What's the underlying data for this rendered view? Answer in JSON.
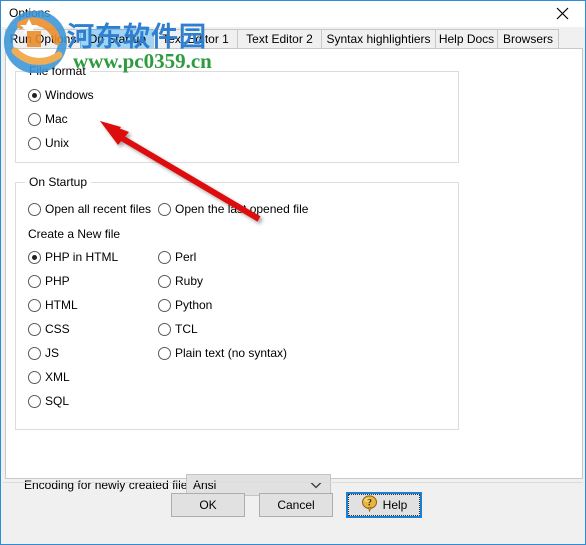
{
  "window": {
    "title": "Options",
    "close_icon": "close-icon",
    "border_color": "#2e8bd6"
  },
  "tabs": [
    {
      "label": "Run Options",
      "selected": false
    },
    {
      "label": "On Startup",
      "selected": true
    },
    {
      "label": "Text Editor 1",
      "selected": false
    },
    {
      "label": "Text Editor 2",
      "selected": false
    },
    {
      "label": "Syntax highlightiers",
      "selected": false
    },
    {
      "label": "Help Docs",
      "selected": false
    },
    {
      "label": "Browsers",
      "selected": false
    }
  ],
  "file_format": {
    "title": "File format",
    "options": [
      {
        "label": "Windows",
        "checked": true
      },
      {
        "label": "Mac",
        "checked": false
      },
      {
        "label": "Unix",
        "checked": false
      }
    ]
  },
  "on_startup": {
    "title": "On Startup",
    "startup_options": [
      {
        "label": "Open all recent files",
        "checked": false
      },
      {
        "label": "Open the last opened file",
        "checked": false
      }
    ],
    "create_new_label": "Create a New file",
    "new_file_left": [
      {
        "label": "PHP in HTML",
        "checked": true
      },
      {
        "label": "PHP",
        "checked": false
      },
      {
        "label": "HTML",
        "checked": false
      },
      {
        "label": "CSS",
        "checked": false
      },
      {
        "label": "JS",
        "checked": false
      },
      {
        "label": "XML",
        "checked": false
      },
      {
        "label": "SQL",
        "checked": false
      }
    ],
    "new_file_right": [
      {
        "label": "Perl",
        "checked": false
      },
      {
        "label": "Ruby",
        "checked": false
      },
      {
        "label": "Python",
        "checked": false
      },
      {
        "label": "TCL",
        "checked": false
      },
      {
        "label": "Plain text (no syntax)",
        "checked": false
      }
    ]
  },
  "encoding": {
    "label": "Encoding for newly created files",
    "value": "Ansi",
    "arrow_icon": "chevron-down-icon"
  },
  "buttons": {
    "ok": "OK",
    "cancel": "Cancel",
    "help": "Help",
    "help_icon": "help-question-bubble-icon",
    "focus_color": "#1d7fd4"
  },
  "watermark": {
    "site_name": "河东软件园",
    "url": "www.pc0359.cn",
    "logo_icon": "site-logo-icon",
    "name_color": "#2f7fd0",
    "url_color": "#2e9b3e"
  },
  "annotation": {
    "arrow_icon": "red-arrow-annotation",
    "color": "#dd1111"
  }
}
